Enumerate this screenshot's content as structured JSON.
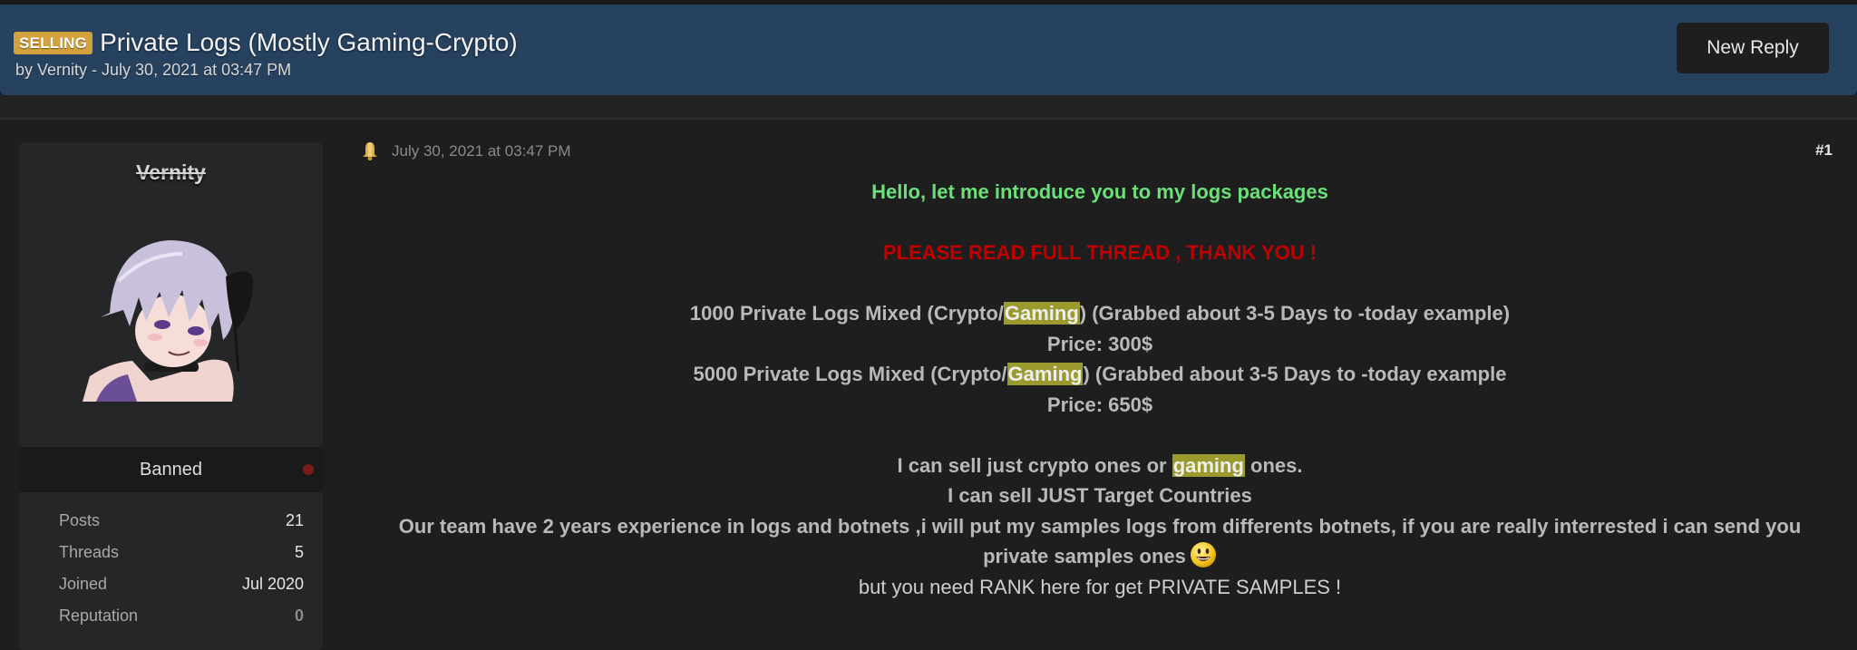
{
  "thread": {
    "prefix": "SELLING",
    "title": "Private Logs (Mostly Gaming-Crypto)",
    "byline": "by Vernity - July 30, 2021 at 03:47 PM",
    "new_reply_label": "New Reply"
  },
  "colors": {
    "header_bg": "#26425f",
    "prefix_badge": "#d4a23c",
    "green_text": "#6be07a",
    "red_text": "#c00000",
    "highlight": "#9a9a2e",
    "status_dot": "#7a1c1c"
  },
  "author": {
    "name": "Vernity",
    "avatar_icon": "anime-avatar-image",
    "usergroup": "Banned",
    "stats": [
      {
        "label": "Posts",
        "value": "21"
      },
      {
        "label": "Threads",
        "value": "5"
      },
      {
        "label": "Joined",
        "value": "Jul 2020"
      },
      {
        "label": "Reputation",
        "value": "0"
      }
    ]
  },
  "post": {
    "icon": "bell-icon",
    "date": "July 30, 2021 at 03:47 PM",
    "number": "#1",
    "intro": "Hello, let me introduce you to my logs packages",
    "warning": "PLEASE READ FULL THREAD , THANK YOU !",
    "package1": {
      "before": "1000 Private Logs Mixed (Crypto/",
      "highlight": "Gaming",
      "after": ") (Grabbed about 3-5 Days to -today example)",
      "price": "Price: 300$"
    },
    "package2": {
      "before": "5000 Private Logs Mixed (Crypto/",
      "highlight": "Gaming",
      "after": ") (Grabbed about 3-5 Days to -today example",
      "price": "Price: 650$"
    },
    "sell_line": {
      "before": "I can sell just crypto ones or ",
      "highlight": "gaming",
      "after": " ones."
    },
    "countries_line": "I can sell JUST Target Countries",
    "team_line": "Our team have 2 years experience in logs and botnets ,i will put my samples logs from differents botnets, if you are really interrested i can send you",
    "samples_line": "private samples ones",
    "smiley_icon": "smiley-icon",
    "rank_line": "but you need RANK here for get PRIVATE SAMPLES !"
  }
}
